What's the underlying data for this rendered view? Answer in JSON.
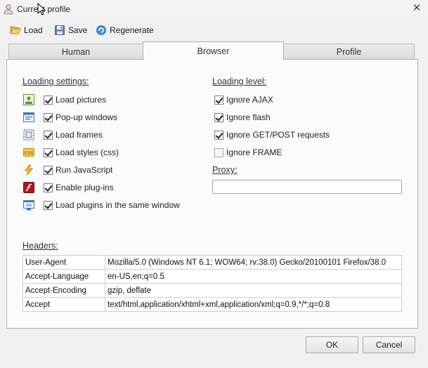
{
  "window": {
    "title": "Current profile"
  },
  "toolbar": {
    "load_label": "Load",
    "save_label": "Save",
    "regenerate_label": "Regenerate"
  },
  "tabs": [
    {
      "label": "Human",
      "active": false
    },
    {
      "label": "Browser",
      "active": true
    },
    {
      "label": "Profile",
      "active": false
    }
  ],
  "loading_settings": {
    "title": "Loading settings:",
    "items": [
      {
        "label": "Load pictures",
        "checked": true,
        "icon": "picture-icon"
      },
      {
        "label": "Pop-up windows",
        "checked": true,
        "icon": "popup-window-icon"
      },
      {
        "label": "Load frames",
        "checked": true,
        "icon": "frames-icon"
      },
      {
        "label": "Load styles (css)",
        "checked": true,
        "icon": "css-icon"
      },
      {
        "label": "Run JavaScript",
        "checked": true,
        "icon": "lightning-icon"
      },
      {
        "label": "Enable plug-ins",
        "checked": true,
        "icon": "flash-plugin-icon"
      },
      {
        "label": "Load plugins in the same window",
        "checked": true,
        "icon": "plugin-window-icon"
      }
    ]
  },
  "loading_level": {
    "title": "Loading level:",
    "items": [
      {
        "label": "Ignore AJAX",
        "checked": true
      },
      {
        "label": "Ignore flash",
        "checked": true
      },
      {
        "label": "Ignore GET/POST requests",
        "checked": true
      },
      {
        "label": "Ignore FRAME",
        "checked": false
      }
    ]
  },
  "proxy": {
    "label": "Proxy:",
    "value": ""
  },
  "headers": {
    "title": "Headers:",
    "rows": [
      {
        "name": "User-Agent",
        "value": "Mozilla/5.0 (Windows NT 6.1; WOW64; rv:38.0) Gecko/20100101 Firefox/38.0"
      },
      {
        "name": "Accept-Language",
        "value": "en-US,en;q=0.5"
      },
      {
        "name": "Accept-Encoding",
        "value": "gzip, deflate"
      },
      {
        "name": "Accept",
        "value": "text/html,application/xhtml+xml,application/xml;q=0.9,*/*;q=0.8"
      }
    ]
  },
  "buttons": {
    "ok_label": "OK",
    "cancel_label": "Cancel"
  }
}
